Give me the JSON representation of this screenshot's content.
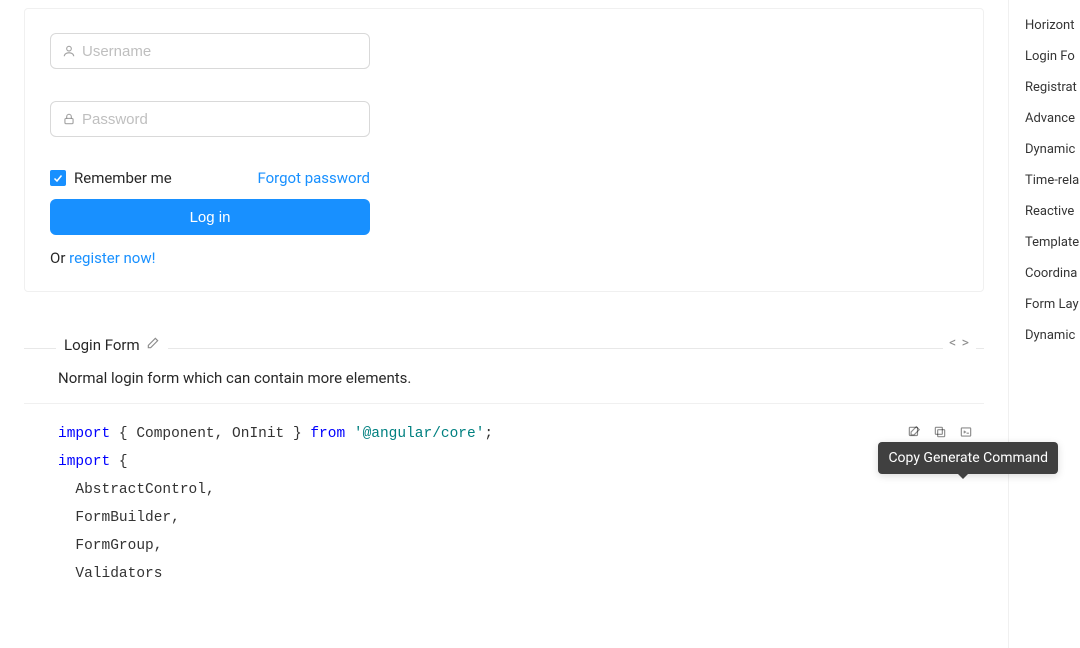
{
  "form": {
    "username_placeholder": "Username",
    "password_placeholder": "Password",
    "remember_label": "Remember me",
    "remember_checked": true,
    "forgot_label": "Forgot password",
    "login_button": "Log in",
    "or_text": "Or ",
    "register_link": "register now!"
  },
  "section": {
    "title": "Login Form",
    "description": "Normal login form which can contain more elements."
  },
  "tooltip": "Copy Generate Command",
  "code": {
    "l1_kw": "import",
    "l1_rest_a": " { Component",
    "l1_comma1": ",",
    "l1_b": " OnInit } ",
    "l1_from": "from",
    "l1_sp": " ",
    "l1_str": "'@angular/core'",
    "l1_semi": ";",
    "l2_kw": "import",
    "l2_rest": " {",
    "l3": "  AbstractControl",
    "l3_comma": ",",
    "l4": "  FormBuilder",
    "l4_comma": ",",
    "l5": "  FormGroup",
    "l5_comma": ",",
    "l6": "  Validators"
  },
  "toc": [
    "Horizont",
    "Login Fo",
    "Registrat",
    "Advance",
    "Dynamic",
    "Time-rela",
    "Reactive",
    "Template",
    "Coordina",
    "Form Lay",
    "Dynamic"
  ]
}
